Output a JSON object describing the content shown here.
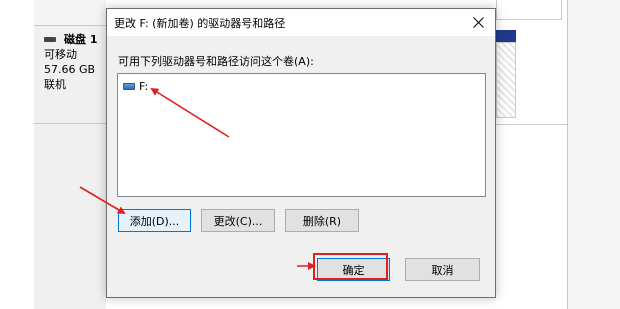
{
  "background": {
    "disk": {
      "name": "磁盘 1",
      "type": "可移动",
      "size": "57.66 GB",
      "status": "联机"
    }
  },
  "dialog": {
    "title": "更改 F: (新加卷) 的驱动器号和路径",
    "prompt": "可用下列驱动器号和路径访问这个卷(A):",
    "items": [
      {
        "label": "F:",
        "icon": "drive-icon"
      }
    ],
    "buttons": {
      "add": "添加(D)...",
      "change": "更改(C)...",
      "remove": "删除(R)",
      "ok": "确定",
      "cancel": "取消"
    }
  },
  "colors": {
    "annotation_red": "#e0201f",
    "focus_blue": "#0078d7"
  }
}
